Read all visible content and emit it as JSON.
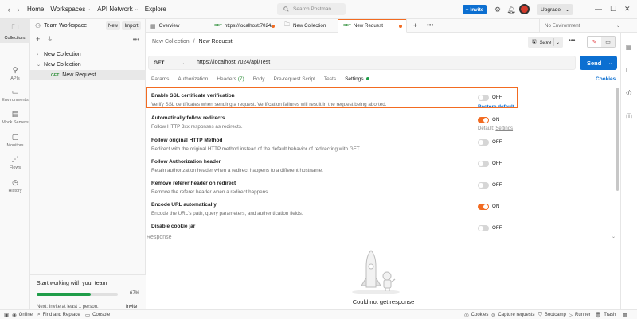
{
  "topbar": {
    "menus": [
      "Home",
      "Workspaces",
      "API Network",
      "Explore"
    ],
    "search_placeholder": "Search Postman",
    "invite_label": "Invite",
    "upgrade_label": "Upgrade"
  },
  "rail": {
    "items": [
      {
        "label": "Collections",
        "icon": "collections-icon",
        "active": true
      },
      {
        "label": "APIs",
        "icon": "apis-icon"
      },
      {
        "label": "Environments",
        "icon": "environments-icon"
      },
      {
        "label": "Mock Servers",
        "icon": "mock-servers-icon"
      },
      {
        "label": "Monitors",
        "icon": "monitors-icon"
      },
      {
        "label": "Flows",
        "icon": "flows-icon"
      },
      {
        "label": "History",
        "icon": "history-icon"
      }
    ]
  },
  "sidebar": {
    "workspace_name": "Team Workspace",
    "new_label": "New",
    "import_label": "Import",
    "tree": [
      {
        "label": "New Collection"
      },
      {
        "label": "New Collection"
      },
      {
        "label": "New Request",
        "method": "GET"
      }
    ],
    "promo": {
      "title": "Start working with your team",
      "progress_percent": 67,
      "progress_label": "67%",
      "next": "Next: Invite at least 1 person.",
      "invite": "Invite"
    }
  },
  "tabs": {
    "items": [
      {
        "label": "Overview",
        "icon": "overview-icon"
      },
      {
        "label": "https://localhost:7024/",
        "method": "GET",
        "unsaved": true
      },
      {
        "label": "New Collection",
        "icon": "collection-icon"
      },
      {
        "label": "New Request",
        "method": "GET",
        "unsaved": true,
        "active": true
      }
    ],
    "environment": "No Environment"
  },
  "request": {
    "breadcrumb_parent": "New Collection",
    "breadcrumb_sep": "/",
    "breadcrumb_current": "New Request",
    "save_label": "Save",
    "method": "GET",
    "url": "https://localhost:7024/api/Test",
    "send_label": "Send",
    "tabs": [
      {
        "label": "Params"
      },
      {
        "label": "Authorization"
      },
      {
        "label": "Headers",
        "count": "(7)"
      },
      {
        "label": "Body"
      },
      {
        "label": "Pre-request Script"
      },
      {
        "label": "Tests"
      },
      {
        "label": "Settings",
        "active": true
      }
    ],
    "cookies_label": "Cookies"
  },
  "settings": [
    {
      "title": "Enable SSL certificate verification",
      "desc": "Verify SSL certificates when sending a request. Verification failures will result in the request being aborted.",
      "state": "OFF",
      "on": false,
      "extra": "Restore default"
    },
    {
      "title": "Automatically follow redirects",
      "desc": "Follow HTTP 3xx responses as redirects.",
      "state": "ON",
      "on": true,
      "default_prefix": "Default: ",
      "default_link": "Settings"
    },
    {
      "title": "Follow original HTTP Method",
      "desc": "Redirect with the original HTTP method instead of the default behavior of redirecting with GET.",
      "state": "OFF",
      "on": false
    },
    {
      "title": "Follow Authorization header",
      "desc": "Retain authorization header when a redirect happens to a different hostname.",
      "state": "OFF",
      "on": false
    },
    {
      "title": "Remove referer header on redirect",
      "desc": "Remove the referer header when a redirect happens.",
      "state": "OFF",
      "on": false
    },
    {
      "title": "Encode URL automatically",
      "desc": "Encode the URL's path, query parameters, and authentication fields.",
      "state": "ON",
      "on": true
    },
    {
      "title": "Disable cookie jar",
      "desc": "",
      "state": "OFF",
      "on": false
    }
  ],
  "response": {
    "label": "Response",
    "message": "Could not get response"
  },
  "statusbar": {
    "left": [
      "Online",
      "Find and Replace",
      "Console"
    ],
    "right": [
      "Cookies",
      "Capture requests",
      "Bootcamp",
      "Runner",
      "Trash"
    ]
  },
  "colors": {
    "accent": "#f26b21",
    "primary": "#0c6fd1",
    "get_method": "#2f8f3a",
    "progress": "#1f9d49"
  }
}
